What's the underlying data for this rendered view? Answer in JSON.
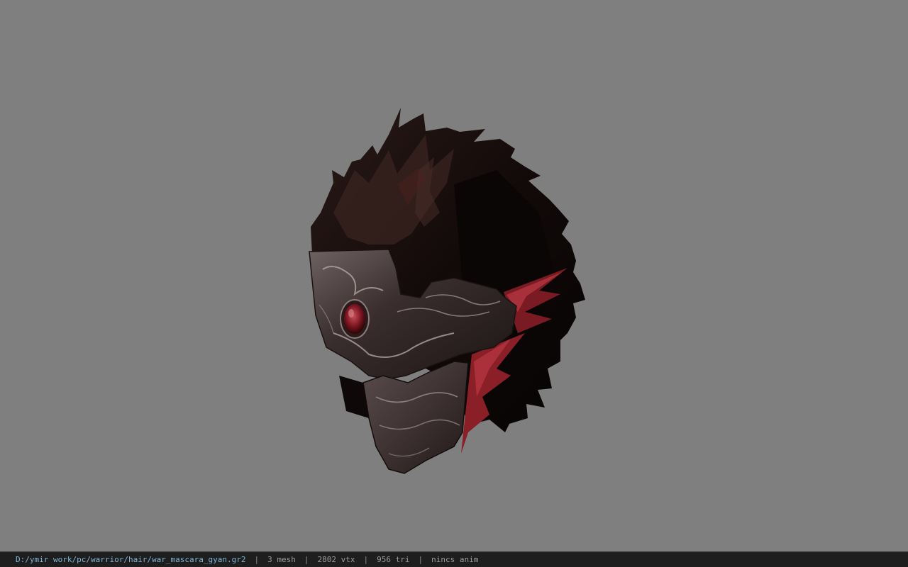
{
  "viewport": {
    "background_color": "#7f7f7f",
    "model_description_icon": "helmet-mask-model"
  },
  "status_bar": {
    "file_path": "D:/ymir work/pc/warrior/hair/war_mascara_gyan.gr2",
    "separator": "|",
    "mesh_count": "3 mesh",
    "vertex_count": "2802 vtx",
    "triangle_count": "956 tri",
    "animation_status": "nincs anim",
    "path_color": "#7fb3d4",
    "bar_color": "#1e1e1e"
  }
}
